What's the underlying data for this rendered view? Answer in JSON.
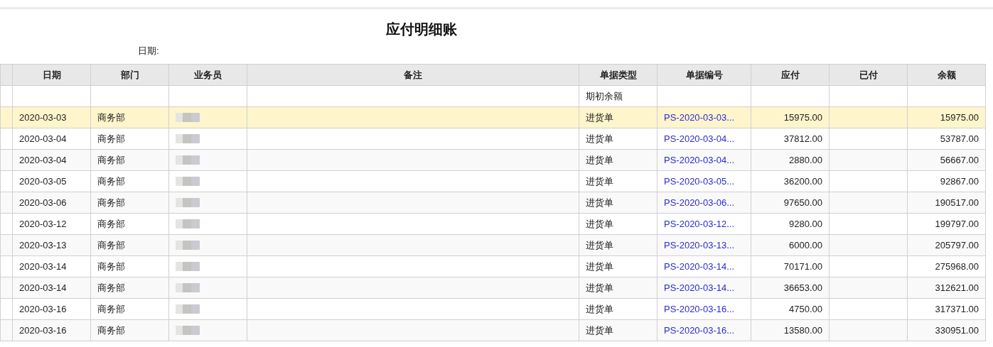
{
  "report": {
    "title": "应付明细账",
    "date_label": "日期:"
  },
  "table": {
    "columns": [
      "日期",
      "部门",
      "业务员",
      "备注",
      "单据类型",
      "单据编号",
      "应付",
      "已付",
      "余额"
    ],
    "rows": [
      {
        "kind": "opening",
        "selected": false,
        "doc_type": "期初余额"
      },
      {
        "kind": "entry",
        "selected": true,
        "date": "2020-03-03",
        "dept": "商务部",
        "doc_type": "进货单",
        "doc_no": "PS-2020-03-03...",
        "payable": "15975.00",
        "balance": "15975.00"
      },
      {
        "kind": "entry",
        "selected": false,
        "date": "2020-03-04",
        "dept": "商务部",
        "doc_type": "进货单",
        "doc_no": "PS-2020-03-04...",
        "payable": "37812.00",
        "balance": "53787.00"
      },
      {
        "kind": "entry",
        "selected": false,
        "date": "2020-03-04",
        "dept": "商务部",
        "doc_type": "进货单",
        "doc_no": "PS-2020-03-04...",
        "payable": "2880.00",
        "balance": "56667.00"
      },
      {
        "kind": "entry",
        "selected": false,
        "date": "2020-03-05",
        "dept": "商务部",
        "doc_type": "进货单",
        "doc_no": "PS-2020-03-05...",
        "payable": "36200.00",
        "balance": "92867.00"
      },
      {
        "kind": "entry",
        "selected": false,
        "date": "2020-03-06",
        "dept": "商务部",
        "doc_type": "进货单",
        "doc_no": "PS-2020-03-06...",
        "payable": "97650.00",
        "balance": "190517.00"
      },
      {
        "kind": "entry",
        "selected": false,
        "date": "2020-03-12",
        "dept": "商务部",
        "doc_type": "进货单",
        "doc_no": "PS-2020-03-12...",
        "payable": "9280.00",
        "balance": "199797.00"
      },
      {
        "kind": "entry",
        "selected": false,
        "date": "2020-03-13",
        "dept": "商务部",
        "doc_type": "进货单",
        "doc_no": "PS-2020-03-13...",
        "payable": "6000.00",
        "balance": "205797.00"
      },
      {
        "kind": "entry",
        "selected": false,
        "date": "2020-03-14",
        "dept": "商务部",
        "doc_type": "进货单",
        "doc_no": "PS-2020-03-14...",
        "payable": "70171.00",
        "balance": "275968.00"
      },
      {
        "kind": "entry",
        "selected": false,
        "date": "2020-03-14",
        "dept": "商务部",
        "doc_type": "进货单",
        "doc_no": "PS-2020-03-14...",
        "payable": "36653.00",
        "balance": "312621.00"
      },
      {
        "kind": "entry",
        "selected": false,
        "date": "2020-03-16",
        "dept": "商务部",
        "doc_type": "进货单",
        "doc_no": "PS-2020-03-16...",
        "payable": "4750.00",
        "balance": "317371.00"
      },
      {
        "kind": "entry",
        "selected": false,
        "date": "2020-03-16",
        "dept": "商务部",
        "doc_type": "进货单",
        "doc_no": "PS-2020-03-16...",
        "payable": "13580.00",
        "balance": "330951.00"
      }
    ]
  }
}
